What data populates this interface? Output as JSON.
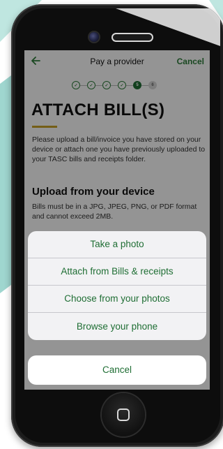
{
  "nav": {
    "title": "Pay a provider",
    "cancel_label": "Cancel",
    "back_icon": "back-arrow-icon"
  },
  "steps": {
    "total": 6,
    "completed": 4,
    "current": 5,
    "labels": [
      "5",
      "6"
    ]
  },
  "main": {
    "heading": "ATTACH BILL(S)",
    "intro": "Please upload a bill/invoice you have stored on your device or attach one you have previously uploaded to your TASC bills and receipts folder.",
    "section_title": "Upload from your device",
    "section_note": "Bills must be in a JPG, JPEG, PNG, or PDF format and cannot exceed 2MB."
  },
  "action_sheet": {
    "options": [
      "Take a photo",
      "Attach from Bills & receipts",
      "Choose from your photos",
      "Browse your phone"
    ],
    "cancel_label": "Cancel"
  },
  "colors": {
    "accent": "#1f6e34",
    "underline": "#c9a227",
    "teal_bg": "#9fd6cf"
  }
}
